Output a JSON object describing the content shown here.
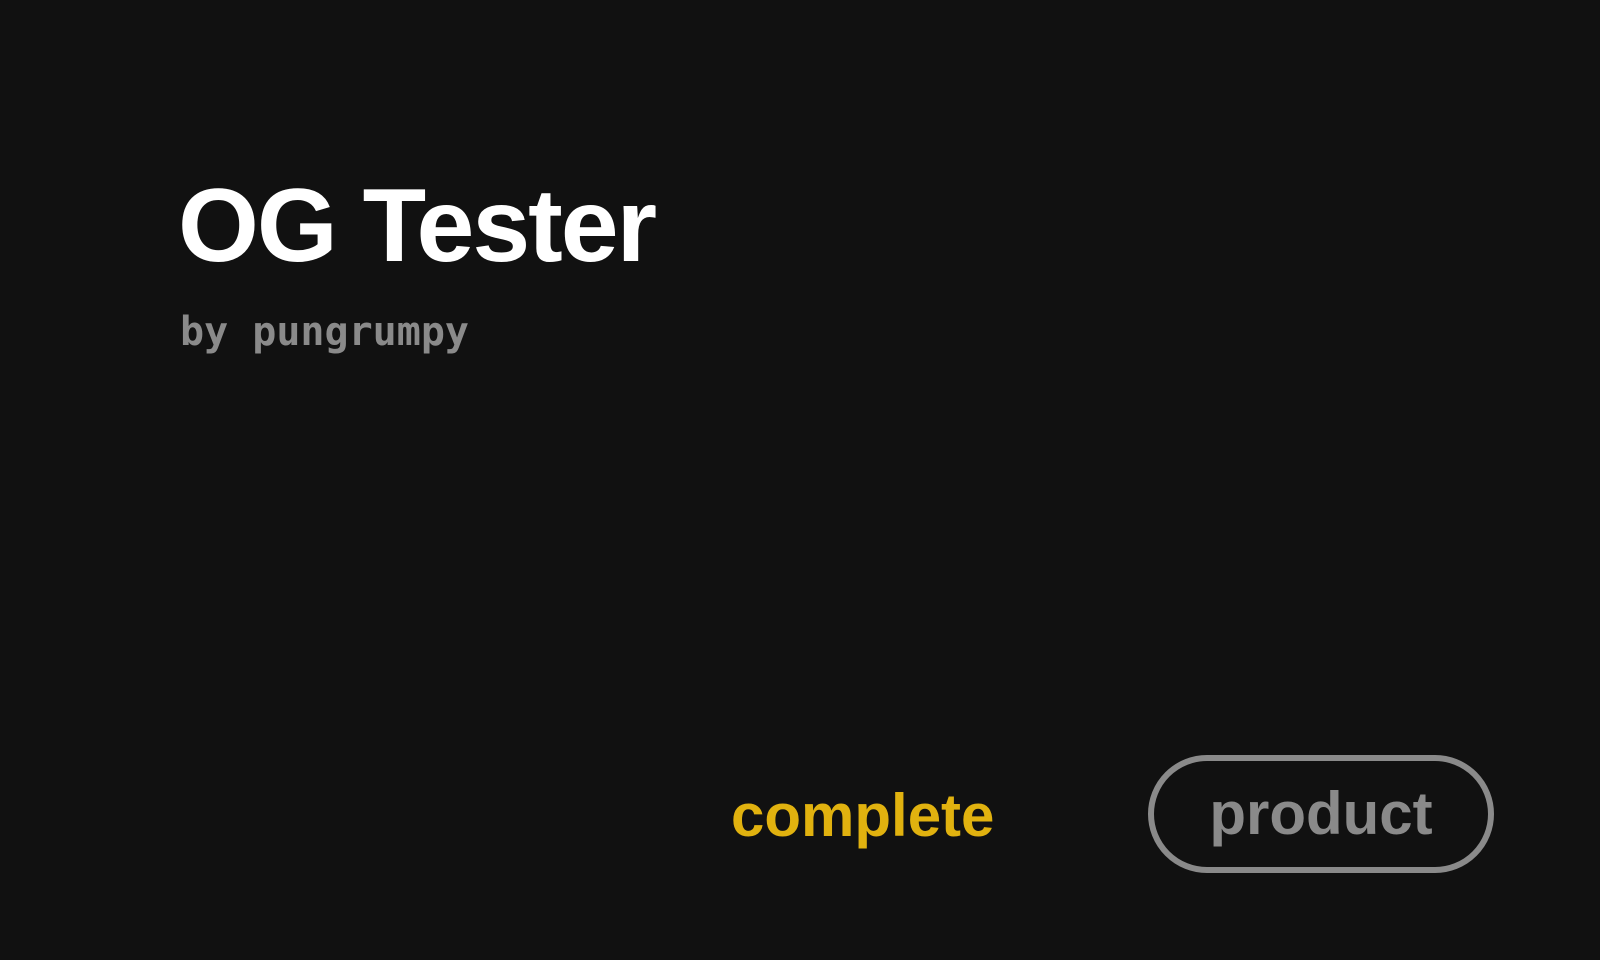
{
  "card": {
    "title": "OG Tester",
    "byline": "by pungrumpy",
    "status": "complete",
    "type": "product"
  },
  "colors": {
    "background": "#111111",
    "title": "#ffffff",
    "muted": "#8a8a8a",
    "accent": "#e1b20f"
  }
}
